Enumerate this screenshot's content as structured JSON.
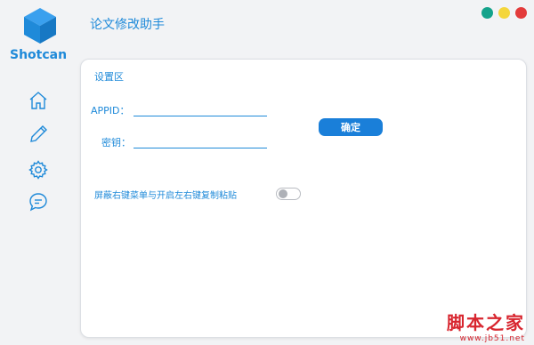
{
  "brand": {
    "name": "Shotcan",
    "logo_icon": "cube-logo-icon",
    "color": "#1f8ad9"
  },
  "app": {
    "title": "论文修改助手"
  },
  "window_controls": [
    {
      "name": "minimize",
      "color": "#14a38b"
    },
    {
      "name": "maximize",
      "color": "#f4d63b"
    },
    {
      "name": "close",
      "color": "#e33b3b"
    }
  ],
  "sidebar": {
    "items": [
      {
        "name": "home",
        "icon": "home-icon"
      },
      {
        "name": "edit",
        "icon": "pencil-icon"
      },
      {
        "name": "settings",
        "icon": "gear-icon"
      },
      {
        "name": "messages",
        "icon": "chat-icon"
      }
    ]
  },
  "settings": {
    "section_title": "设置区",
    "appid_label": "APPID：",
    "appid_value": "",
    "key_label": "密钥：",
    "key_value": "",
    "confirm_label": "确定",
    "toggle_label": "屏蔽右键菜单与开启左右键复制粘贴",
    "toggle_on": false
  },
  "watermark": {
    "main": "脚本之家",
    "sub": "www.jb51.net"
  }
}
